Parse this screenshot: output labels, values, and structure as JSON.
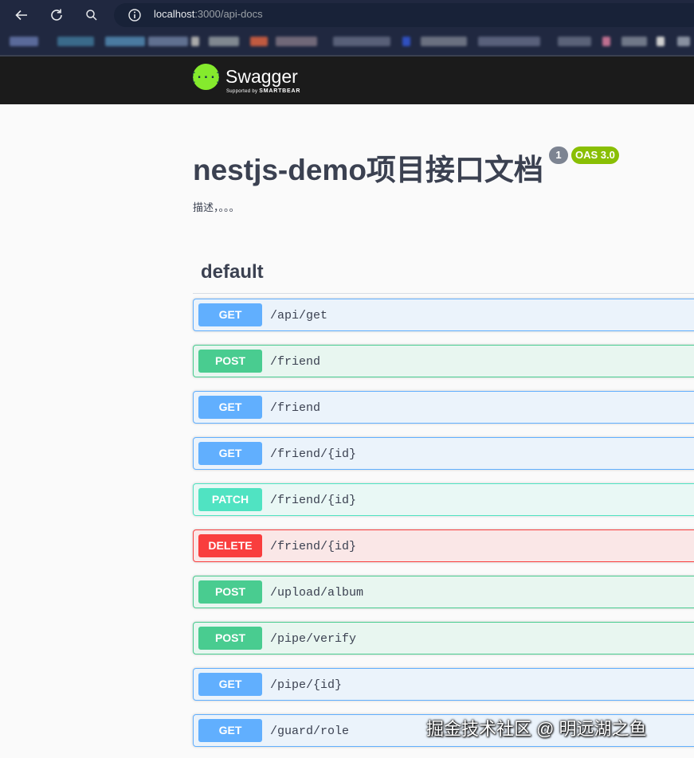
{
  "browser": {
    "url_host": "localhost",
    "url_path": ":3000/api-docs"
  },
  "swagger_logo": {
    "name": "Swagger",
    "sub_prefix": "Supported by ",
    "sub_brand": "SMARTBEAR"
  },
  "info": {
    "title": "nestjs-demo项目接口文档",
    "version": "1",
    "oas": "OAS 3.0",
    "description": "描述，。。。"
  },
  "tag": {
    "name": "default"
  },
  "operations": [
    {
      "method": "GET",
      "path": "/api/get"
    },
    {
      "method": "POST",
      "path": "/friend"
    },
    {
      "method": "GET",
      "path": "/friend"
    },
    {
      "method": "GET",
      "path": "/friend/{id}"
    },
    {
      "method": "PATCH",
      "path": "/friend/{id}"
    },
    {
      "method": "DELETE",
      "path": "/friend/{id}"
    },
    {
      "method": "POST",
      "path": "/upload/album"
    },
    {
      "method": "POST",
      "path": "/pipe/verify"
    },
    {
      "method": "GET",
      "path": "/pipe/{id}"
    },
    {
      "method": "GET",
      "path": "/guard/role"
    }
  ],
  "watermark": "掘金技术社区 @ 明远湖之鱼",
  "colors": {
    "get": "#61affe",
    "post": "#49cc90",
    "patch": "#50e3c2",
    "delete": "#f93e3e",
    "oas_badge": "#89bf04",
    "swagger_green": "#85ea2d"
  }
}
